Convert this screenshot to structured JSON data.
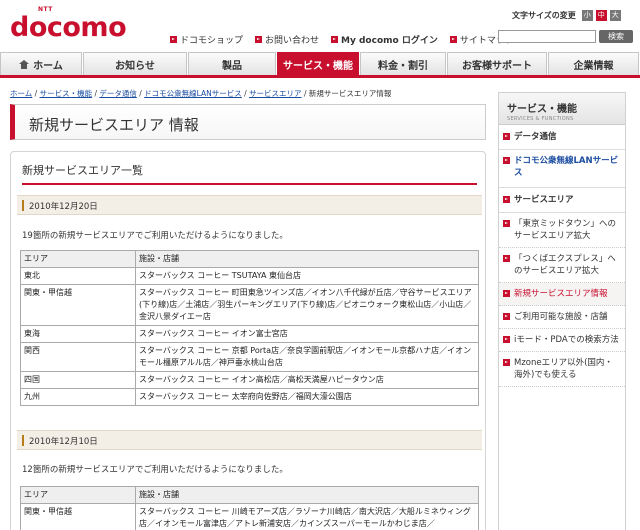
{
  "header": {
    "logo_ntt": "NTT",
    "logo_name": "docomo",
    "font_size_label": "文字サイズの変更",
    "font_sizes": [
      "小",
      "中",
      "大"
    ],
    "top_links": [
      "ドコモショップ",
      "お問い合わせ",
      "My docomo ログイン",
      "サイトマップ"
    ],
    "search_placeholder": "",
    "search_button": "検索"
  },
  "nav": {
    "tabs": [
      {
        "label": "ホーム"
      },
      {
        "label": "お知らせ"
      },
      {
        "label": "製品"
      },
      {
        "label": "サービス・機能"
      },
      {
        "label": "料金・割引"
      },
      {
        "label": "お客様サポート"
      },
      {
        "label": "企業情報"
      }
    ]
  },
  "breadcrumb": {
    "items": [
      "ホーム",
      "サービス・機能",
      "データ通信",
      "ドコモ公衆無線LANサービス",
      "サービスエリア"
    ],
    "current": "新規サービスエリア情報"
  },
  "page_title": "新規サービスエリア 情報",
  "section_title": "新規サービスエリア一覧",
  "entries": [
    {
      "date": "2010年12月20日",
      "intro": "19箇所の新規サービスエリアでご利用いただけるようになりました。",
      "header": [
        "エリア",
        "施設・店舗"
      ],
      "rows": [
        [
          "東北",
          "スターバックス コーヒー TSUTAYA 東仙台店"
        ],
        [
          "関東・甲信越",
          "スターバックス コーヒー 町田東急ツインズ店／イオン八千代緑が丘店／守谷サービスエリア(下り線)店／土浦店／羽生パーキングエリア(下り線)店／ピオニウォーク東松山店／小山店／金沢八景ダイエー店"
        ],
        [
          "東海",
          "スターバックス コーヒー イオン富士宮店"
        ],
        [
          "関西",
          "スターバックス コーヒー 京都 Porta店／奈良学園前駅店／イオンモール京都ハナ店／イオンモール橿原アルル店／神戸垂水桃山台店"
        ],
        [
          "四国",
          "スターバックス コーヒー イオン高松店／高松天満屋ハピータウン店"
        ],
        [
          "九州",
          "スターバックス コーヒー 太宰府向佐野店／福岡大濠公園店"
        ]
      ]
    },
    {
      "date": "2010年12月10日",
      "intro": "12箇所の新規サービスエリアでご利用いただけるようになりました。",
      "header": [
        "エリア",
        "施設・店舗"
      ],
      "rows": [
        [
          "関東・甲信越",
          "スターバックス コーヒー 川崎モアーズ店／ラゾーナ川崎店／南大沢店／大船ルミネウィング店／イオンモール富津店／アトレ新浦安店／カインズスーパーモールかわじま店／"
        ]
      ]
    }
  ],
  "sidebar": {
    "title": "サービス・機能",
    "subtitle": "SERVICES & FUNCTIONS",
    "sec_data": "データ通信",
    "sec_wlan": "ドコモ公衆無線LANサービス",
    "sec_area": "サービスエリア",
    "items": [
      "「東京ミッドタウン」へのサービスエリア拡大",
      "「つくばエクスプレス」へのサービスエリア拡大",
      "新規サービスエリア情報",
      "ご利用可能な施設・店舗",
      "iモード・PDAでの検索方法",
      "Mzoneエリア以外(国内・海外)でも使える"
    ]
  },
  "colors": {
    "brand_red": "#c8102e",
    "link_blue": "#1a4ca0"
  }
}
